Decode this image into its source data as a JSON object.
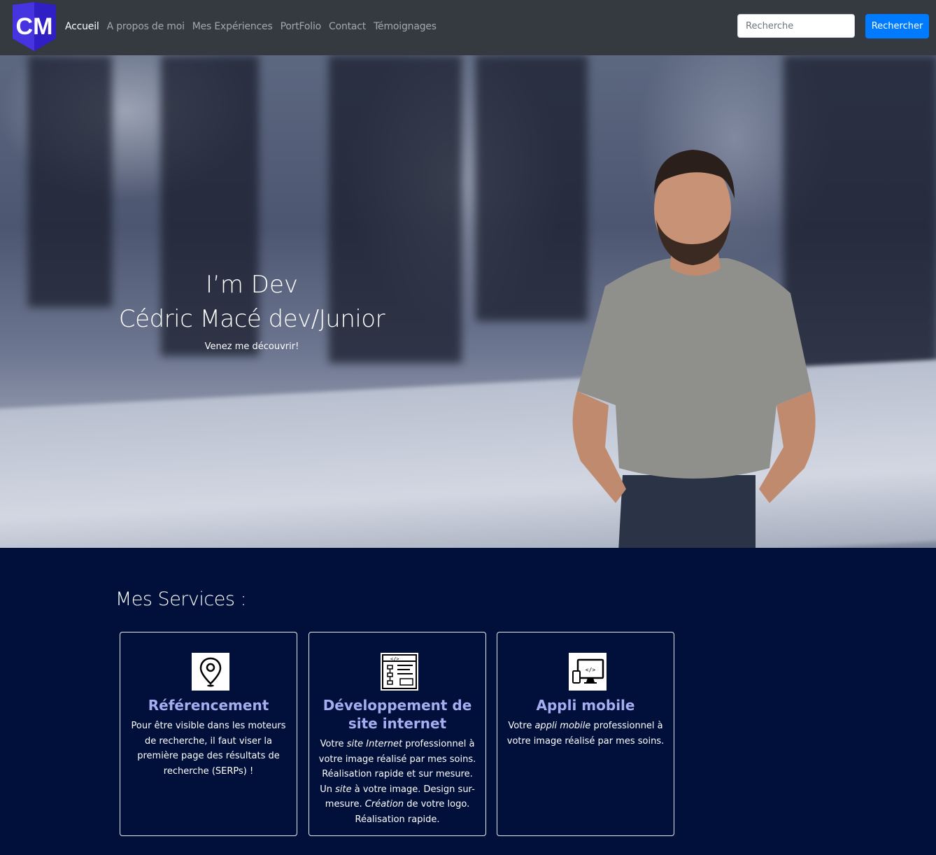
{
  "nav": {
    "logo_text": "CM",
    "links": [
      "Accueil",
      "A propos de moi",
      "Mes Expériences",
      "PortFolio",
      "Contact",
      "Témoignages"
    ],
    "active": "Accueil",
    "search_placeholder": "Recherche",
    "search_button": "Rechercher"
  },
  "hero": {
    "line1": "I’m Dev",
    "line2": "Cédric Macé dev/Junior",
    "subtitle": "Venez me découvrir!"
  },
  "services": {
    "title": "Mes Services :",
    "cards": [
      {
        "icon": "map-pin-icon",
        "title": "Référencement",
        "text": "Pour être visible dans les moteurs de recherche, il faut viser la première page des résultats de recherche (SERPs) !"
      },
      {
        "icon": "web-development-icon",
        "title": "Développement de site internet",
        "text_parts": [
          "Votre ",
          "site Internet",
          " professionnel à votre image réalisé par mes soins. Réalisation rapide et sur mesure. Un ",
          "site",
          " à votre image. Design sur-mesure. ",
          "Création",
          " de votre logo. Réalisation rapide."
        ]
      },
      {
        "icon": "mobile-app-icon",
        "title": "Appli mobile",
        "text_parts": [
          "Votre ",
          "appli mobile",
          " professionnel à votre image réalisé par mes soins."
        ]
      }
    ]
  },
  "colors": {
    "navbar": "#343a40",
    "primary": "#007bff",
    "services_bg": "#00103a",
    "card_title": "#a4aef0",
    "logo": "#2f1fc4"
  }
}
